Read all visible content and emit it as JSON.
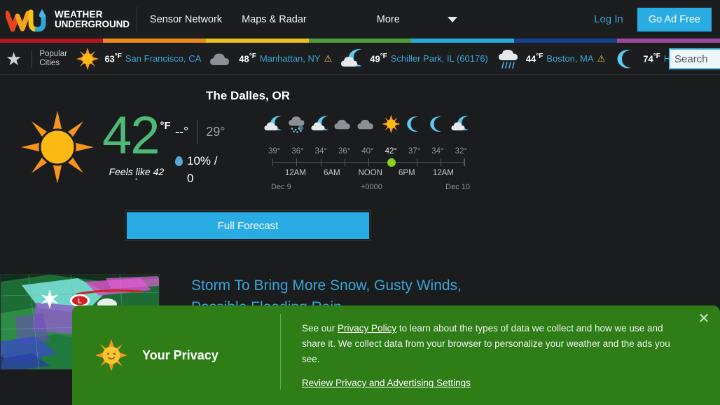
{
  "header": {
    "brand_line1": "WEATHER",
    "brand_line2": "UNDERGROUND",
    "logo_icon": "wu-logo-icon",
    "nav": [
      {
        "label": "Sensor Network",
        "name": "nav-sensor-network"
      },
      {
        "label": "Maps & Radar",
        "name": "nav-maps-radar"
      }
    ],
    "more_label": "More",
    "more_icon": "chevron-down-icon",
    "login_label": "Log In",
    "go_ad_free_label": "Go Ad Free",
    "accent_color": "#29ace3"
  },
  "stripe_colors": [
    "#b3161f",
    "#e98b1e",
    "#e9c01e",
    "#4f9e3a",
    "#2aa8d8",
    "#14418f",
    "#9b4a9e"
  ],
  "cities_bar": {
    "star_icon": "star-icon",
    "popular_label_line1": "Popular",
    "popular_label_line2": "Cities",
    "search_value": "Search",
    "items": [
      {
        "icon": "sunny-icon",
        "temp": "63",
        "unit": "°F",
        "name": "San Francisco, CA",
        "alert": false
      },
      {
        "icon": "cloudy-icon",
        "temp": "48",
        "unit": "°F",
        "name": "Manhattan, NY",
        "alert": true
      },
      {
        "icon": "partly-cloudy-night-icon",
        "temp": "49",
        "unit": "°F",
        "name": "Schiller Park, IL (60176)",
        "alert": false
      },
      {
        "icon": "rain-icon",
        "temp": "44",
        "unit": "°F",
        "name": "Boston, MA",
        "alert": true
      },
      {
        "icon": "clear-night-icon",
        "temp": "74",
        "unit": "°F",
        "name": "Houston, TX",
        "alert": false
      }
    ]
  },
  "current": {
    "location": "The Dalles, OR",
    "icon": "sunny-icon",
    "temperature": "42",
    "unit": "°F",
    "feels_like": "Feels like 42",
    "feels_like_degree": "°",
    "high": "--°",
    "low": "29°",
    "precip_icon": "water-drop-icon",
    "precip": "10% / 0",
    "full_forecast_label": "Full Forecast"
  },
  "hourly": {
    "icons": [
      "partly-cloudy-night-icon",
      "snow-icon",
      "partly-cloudy-night-icon",
      "cloudy-icon",
      "cloudy-icon",
      "sunny-icon",
      "clear-night-icon",
      "clear-night-icon",
      "partly-cloudy-night-icon"
    ],
    "temps": [
      "39°",
      "36°",
      "34°",
      "36°",
      "40°",
      "42°",
      "37°",
      "34°",
      "32°"
    ],
    "current_index": 5,
    "now_marker_pct": 62,
    "time_labels": [
      {
        "label": "12AM",
        "pct": 12
      },
      {
        "label": "6AM",
        "pct": 31
      },
      {
        "label": "NOON",
        "pct": 51
      },
      {
        "label": "6PM",
        "pct": 70
      },
      {
        "label": "12AM",
        "pct": 89
      }
    ],
    "date_left": "Dec 9",
    "timezone": "+0000",
    "date_right": "Dec 10"
  },
  "article": {
    "title": "Storm To Bring More Snow, Gusty Winds, Possible Flooding Rain",
    "thumbnail_name": "radar-map-thumbnail"
  },
  "privacy": {
    "icon": "smiling-sun-icon",
    "title": "Your Privacy",
    "body_prefix": "See our ",
    "policy_link": "Privacy Policy",
    "body_suffix": " to learn about the types of data we collect and how we use and share it. We collect data from your browser to personalize your weather and the ads you see.",
    "review_link": "Review Privacy and Advertising Settings",
    "close_icon": "close-icon",
    "background_color": "#2e7d16"
  }
}
